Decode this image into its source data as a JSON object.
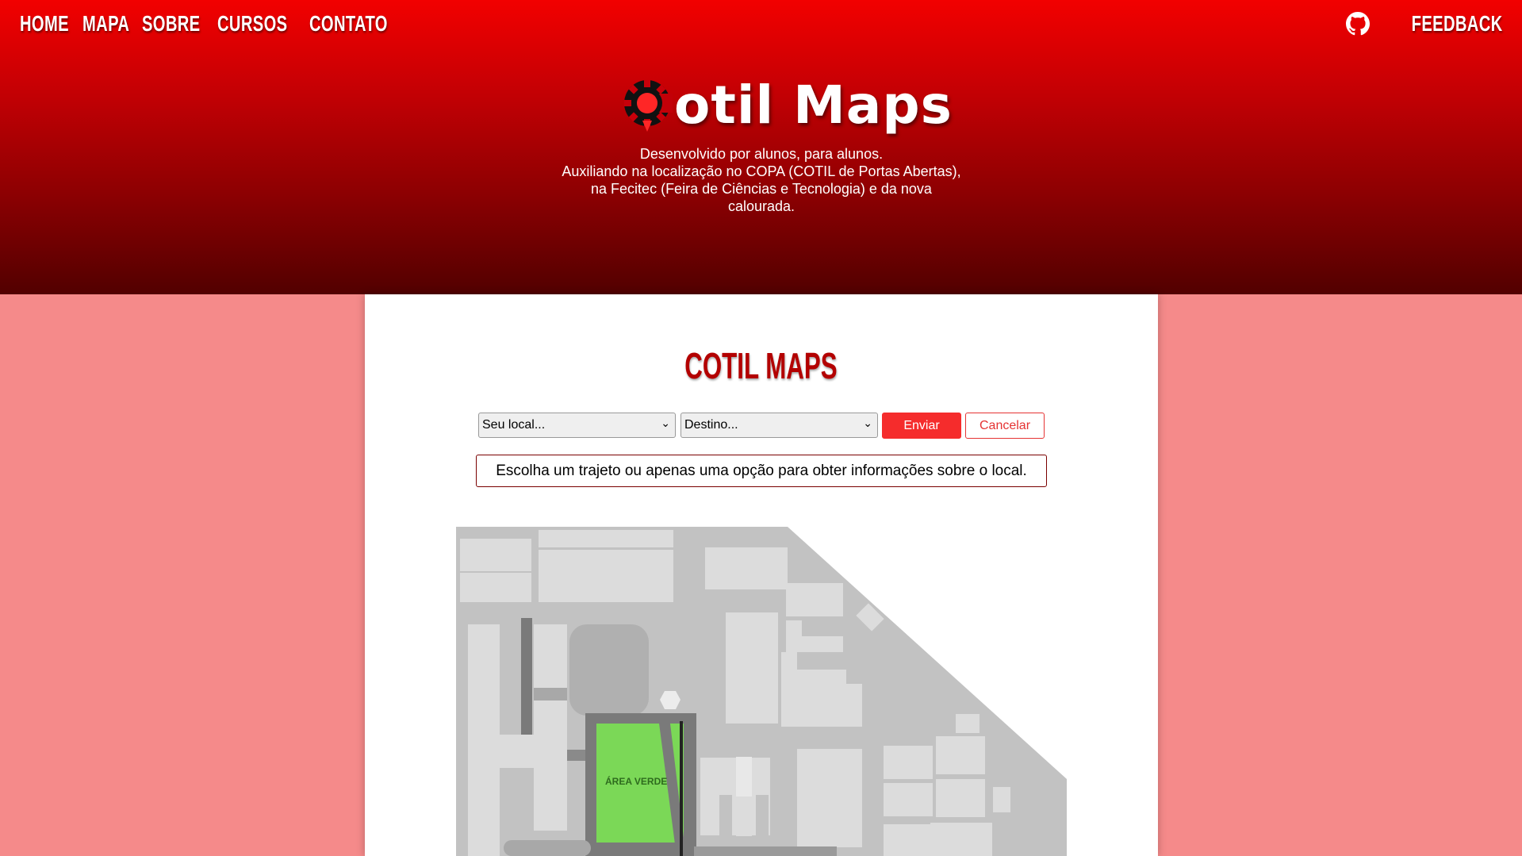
{
  "nav": {
    "items": [
      {
        "label": "Home"
      },
      {
        "label": "Mapa"
      },
      {
        "label": "Sobre"
      },
      {
        "label": "Cursos"
      },
      {
        "label": "Contato"
      }
    ],
    "feedback_label": "Feedback",
    "feedback_icon": "github-icon"
  },
  "hero": {
    "logo_text": "otil Maps",
    "logo_icon": "map-pin-gear-icon",
    "subtitle_line1": "Desenvolvido por alunos, para alunos.",
    "subtitle_line2": "Auxiliando na localização no COPA (COTIL de Portas Abertas), na Fecitec (Feira de Ciências e Tecnologia) e da nova calourada."
  },
  "main": {
    "title": "Cotil Maps",
    "origin_select": {
      "value": "Seu local..."
    },
    "destination_select": {
      "value": "Destino..."
    },
    "send_label": "Enviar",
    "cancel_label": "Cancelar",
    "info_text": "Escolha um trajeto ou apenas uma opção para obter informações sobre o local."
  },
  "map": {
    "green_area_label": "ÁREA VERDE"
  },
  "colors": {
    "header_top": "#f20000",
    "header_bottom": "#520000",
    "page_bg": "#f58a8a",
    "accent": "#f52c2c",
    "title": "#b30000",
    "green_area": "#7bd857"
  }
}
